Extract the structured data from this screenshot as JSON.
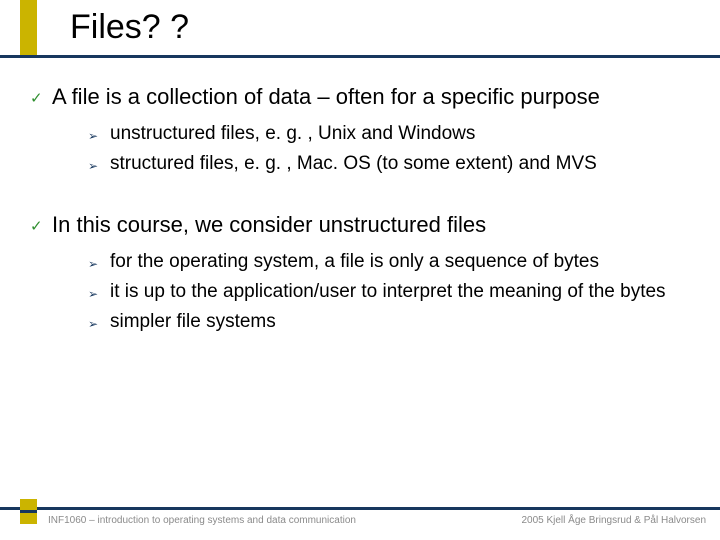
{
  "title": "Files? ?",
  "bullets": [
    {
      "text": "A file is a collection of data – often for a specific purpose",
      "children": [
        "unstructured files, e. g. , Unix and Windows",
        "structured files, e. g. , Mac. OS (to some extent) and MVS"
      ]
    },
    {
      "text": "In this course, we consider unstructured files",
      "children": [
        "for the operating system, a file is only a sequence of bytes",
        "it is up to the application/user to interpret the meaning of the bytes",
        "simpler file systems"
      ]
    }
  ],
  "footer": {
    "left": "INF1060 – introduction to operating systems and data communication",
    "right": "2005 Kjell Åge Bringsrud & Pål Halvorsen"
  },
  "glyphs": {
    "check": "✓",
    "arrow": "➢"
  }
}
